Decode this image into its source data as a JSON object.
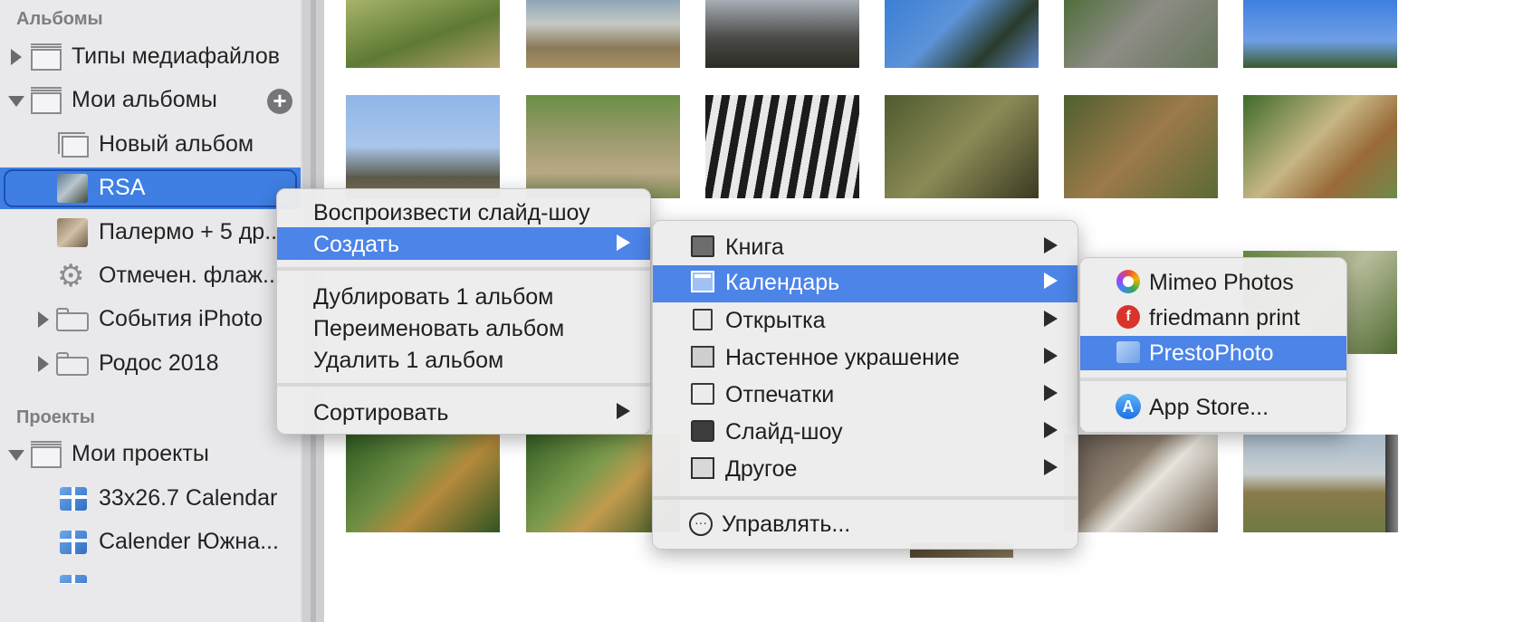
{
  "sidebar": {
    "albums_header": "Альбомы",
    "projects_header": "Проекты",
    "items": [
      {
        "label": "Типы медиафайлов"
      },
      {
        "label": "Мои альбомы"
      },
      {
        "label": "Новый альбом"
      },
      {
        "label": "RSA"
      },
      {
        "label": "Палермо + 5 др..."
      },
      {
        "label": "Отмечен. флаж..."
      },
      {
        "label": "События iPhoto"
      },
      {
        "label": "Родос 2018"
      },
      {
        "label": "Мои проекты"
      },
      {
        "label": "33x26.7 Calendar"
      },
      {
        "label": "Calender Южна..."
      }
    ],
    "add_button": "+"
  },
  "context_menu": {
    "items": [
      {
        "label": "Воспроизвести слайд-шоу"
      },
      {
        "label": "Создать"
      },
      {
        "label": "Дублировать 1 альбом"
      },
      {
        "label": "Переименовать альбом"
      },
      {
        "label": "Удалить 1 альбом"
      },
      {
        "label": "Сортировать"
      }
    ]
  },
  "create_submenu": {
    "items": [
      {
        "label": "Книга",
        "icon": "book-icon"
      },
      {
        "label": "Календарь",
        "icon": "calendar-icon"
      },
      {
        "label": "Открытка",
        "icon": "card-icon"
      },
      {
        "label": "Настенное украшение",
        "icon": "wall-decor-icon"
      },
      {
        "label": "Отпечатки",
        "icon": "prints-icon"
      },
      {
        "label": "Слайд-шоу",
        "icon": "slideshow-icon"
      },
      {
        "label": "Другое",
        "icon": "other-icon"
      }
    ],
    "manage": {
      "label": "Управлять...",
      "glyph": "···"
    }
  },
  "calendar_submenu": {
    "items": [
      {
        "label": "Mimeo Photos"
      },
      {
        "label": "friedmann print",
        "glyph": "f"
      },
      {
        "label": "PrestoPhoto"
      },
      {
        "label": "App Store...",
        "glyph": "A"
      }
    ]
  },
  "colors": {
    "selection": "#4c84e8",
    "sidebar_bg": "#e9e9ec",
    "menu_bg": "#ececec"
  }
}
